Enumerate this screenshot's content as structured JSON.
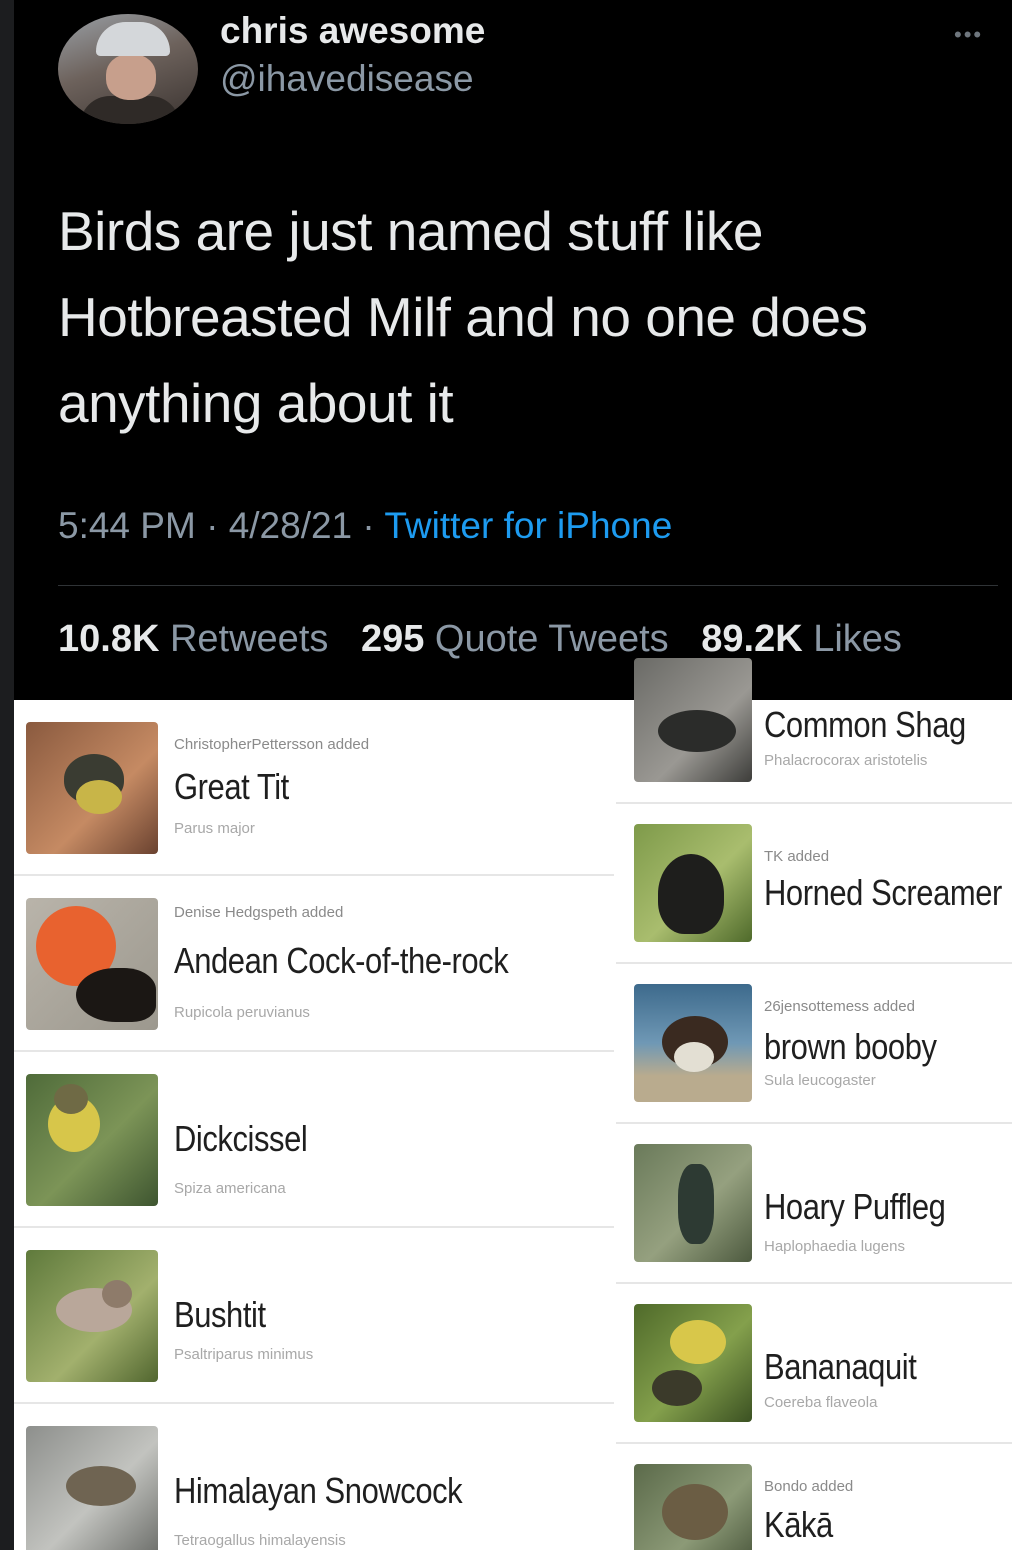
{
  "tweet": {
    "user_name": "chris awesome",
    "user_handle": "@ihavedisease",
    "text_lines": [
      "Birds are just named stuff like",
      "Hotbreasted Milf and no one does",
      "anything about it"
    ],
    "time": "5:44 PM",
    "date": "4/28/21",
    "source": "Twitter for iPhone",
    "stats": {
      "retweets_count": "10.8K",
      "retweets_label": "Retweets",
      "quotes_count": "295",
      "quotes_label": "Quote Tweets",
      "likes_count": "89.2K",
      "likes_label": "Likes"
    },
    "colors": {
      "background": "#000000",
      "text": "#e7e9ea",
      "muted": "#8b98a5",
      "link": "#1d9bf0"
    }
  },
  "birds_left": [
    {
      "added_by": "ChristopherPettersson added",
      "name": "Great Tit",
      "scientific": "Parus major"
    },
    {
      "added_by": "Denise Hedgspeth added",
      "name": "Andean Cock-of-the-rock",
      "scientific": "Rupicola peruvianus"
    },
    {
      "added_by": "",
      "name": "Dickcissel",
      "scientific": "Spiza americana"
    },
    {
      "added_by": "",
      "name": "Bushtit",
      "scientific": "Psaltriparus minimus"
    },
    {
      "added_by": "",
      "name": "Himalayan Snowcock",
      "scientific": "Tetraogallus himalayensis"
    }
  ],
  "birds_right": [
    {
      "added_by": "",
      "name": "Common Shag",
      "scientific": "Phalacrocorax aristotelis"
    },
    {
      "added_by": "TK added",
      "name": "Horned Screamer",
      "scientific": ""
    },
    {
      "added_by": "26jensottemess added",
      "name": "brown booby",
      "scientific": "Sula leucogaster"
    },
    {
      "added_by": "",
      "name": "Hoary Puffleg",
      "scientific": "Haplophaedia lugens"
    },
    {
      "added_by": "",
      "name": "Bananaquit",
      "scientific": "Coereba flaveola"
    },
    {
      "added_by": "Bondo added",
      "name": "Kākā",
      "scientific": ""
    }
  ]
}
